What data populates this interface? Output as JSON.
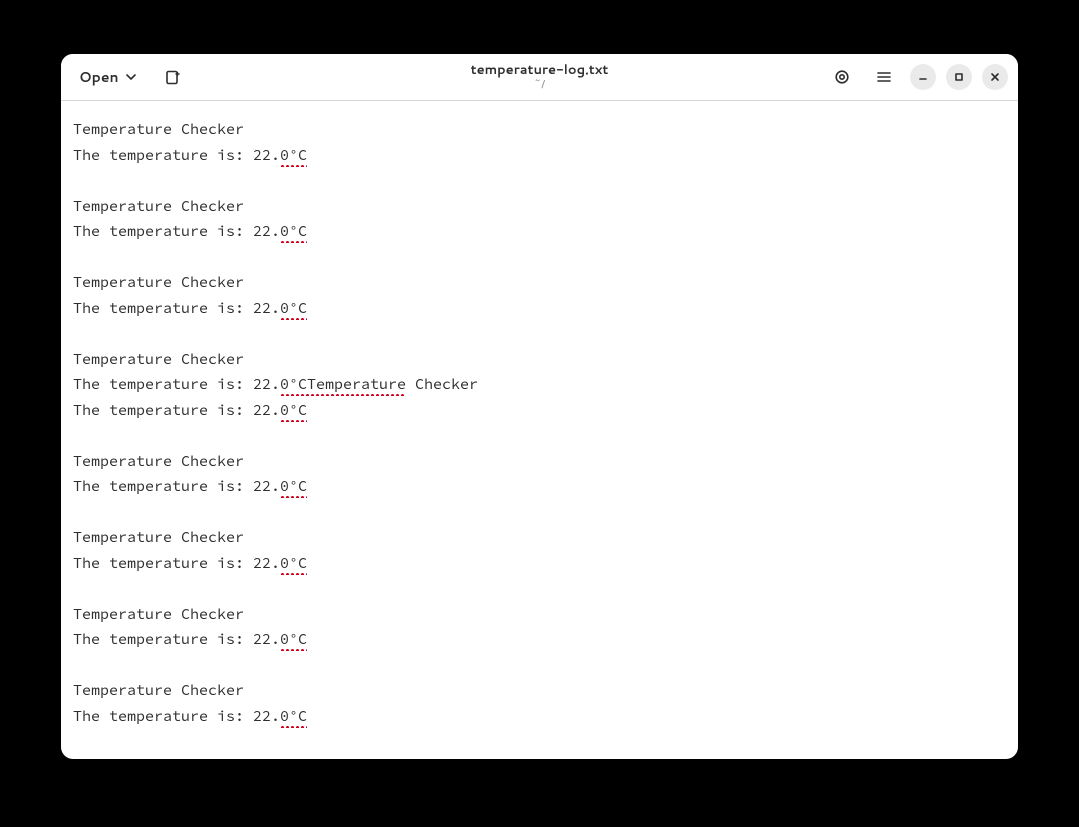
{
  "header": {
    "open_label": "Open",
    "title": "temperature-log.txt",
    "subtitle": "~/"
  },
  "lines": [
    {
      "kind": "plain",
      "text": "Temperature Checker"
    },
    {
      "kind": "temp",
      "prefix": "The temperature is: 22.",
      "spell": "0°C",
      "tail": ""
    },
    {
      "kind": "blank"
    },
    {
      "kind": "plain",
      "text": "Temperature Checker"
    },
    {
      "kind": "temp",
      "prefix": "The temperature is: 22.",
      "spell": "0°C",
      "tail": ""
    },
    {
      "kind": "blank"
    },
    {
      "kind": "plain",
      "text": "Temperature Checker"
    },
    {
      "kind": "temp",
      "prefix": "The temperature is: 22.",
      "spell": "0°C",
      "tail": ""
    },
    {
      "kind": "blank"
    },
    {
      "kind": "plain",
      "text": "Temperature Checker"
    },
    {
      "kind": "temp",
      "prefix": "The temperature is: 22.",
      "spell": "0°CTemperature",
      "tail": " Checker"
    },
    {
      "kind": "temp",
      "prefix": "The temperature is: 22.",
      "spell": "0°C",
      "tail": ""
    },
    {
      "kind": "blank"
    },
    {
      "kind": "plain",
      "text": "Temperature Checker"
    },
    {
      "kind": "temp",
      "prefix": "The temperature is: 22.",
      "spell": "0°C",
      "tail": ""
    },
    {
      "kind": "blank"
    },
    {
      "kind": "plain",
      "text": "Temperature Checker"
    },
    {
      "kind": "temp",
      "prefix": "The temperature is: 22.",
      "spell": "0°C",
      "tail": ""
    },
    {
      "kind": "blank"
    },
    {
      "kind": "plain",
      "text": "Temperature Checker"
    },
    {
      "kind": "temp",
      "prefix": "The temperature is: 22.",
      "spell": "0°C",
      "tail": ""
    },
    {
      "kind": "blank"
    },
    {
      "kind": "plain",
      "text": "Temperature Checker"
    },
    {
      "kind": "temp",
      "prefix": "The temperature is: 22.",
      "spell": "0°C",
      "tail": ""
    }
  ]
}
